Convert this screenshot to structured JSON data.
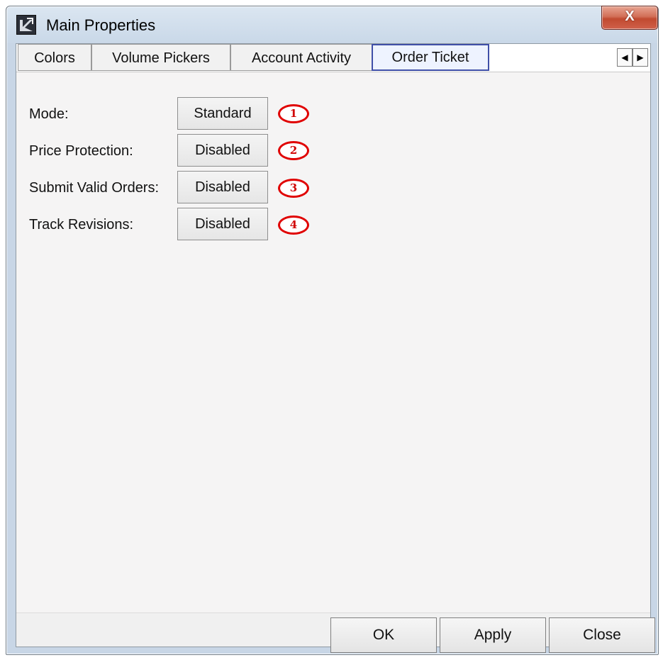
{
  "window": {
    "title": "Main Properties",
    "close_glyph": "X",
    "app_icon": "app-logo-icon"
  },
  "tabs": [
    {
      "label": "Colors"
    },
    {
      "label": "Volume Pickers"
    },
    {
      "label": "Account Activity"
    },
    {
      "label": "Order Ticket",
      "active": true
    }
  ],
  "tab_scroll": {
    "left_glyph": "◀",
    "right_glyph": "▶"
  },
  "settings": [
    {
      "label": "Mode:",
      "value": "Standard",
      "marker": "1"
    },
    {
      "label": "Price Protection:",
      "value": "Disabled",
      "marker": "2"
    },
    {
      "label": "Submit Valid Orders:",
      "value": "Disabled",
      "marker": "3"
    },
    {
      "label": "Track Revisions:",
      "value": "Disabled",
      "marker": "4"
    }
  ],
  "footer": {
    "ok_label": "OK",
    "apply_label": "Apply",
    "close_label": "Close"
  },
  "colors": {
    "active_tab_border": "#3f4fa8",
    "marker_red": "#e00000",
    "close_button": "#c14a30"
  }
}
